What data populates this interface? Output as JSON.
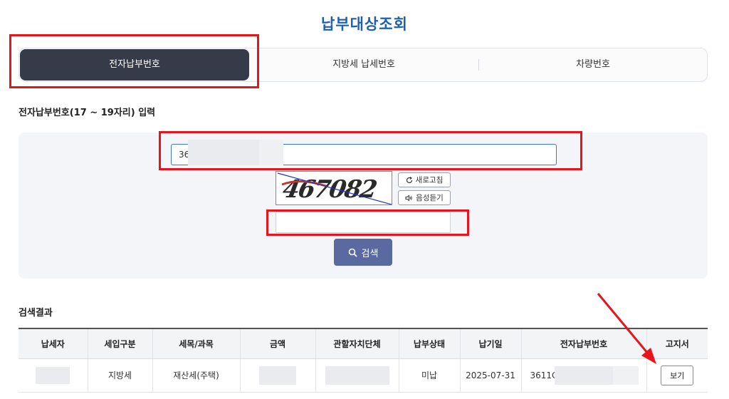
{
  "page": {
    "title": "납부대상조회"
  },
  "tabs": [
    {
      "label": "전자납부번호",
      "active": true
    },
    {
      "label": "지방세 납세번호",
      "active": false
    },
    {
      "label": "차량번호",
      "active": false
    }
  ],
  "form": {
    "section_label": "전자납부번호(17 ~ 19자리) 입력",
    "epay_input_value": "36",
    "captcha_text": "467082",
    "refresh_label": "새로고침",
    "listen_label": "음성듣기",
    "search_label": "검색"
  },
  "results": {
    "title": "검색결과",
    "columns": [
      "납세자",
      "세입구분",
      "세목/과목",
      "금액",
      "관할자치단체",
      "납부상태",
      "납기일",
      "전자납부번호",
      "고지서"
    ],
    "rows": [
      {
        "taxpayer": "",
        "revenue_type": "지방세",
        "tax_item": "재산세(주택)",
        "amount": "",
        "jurisdiction": "",
        "status": "미납",
        "due_date": "2025-07-31",
        "epay_number": "3611C",
        "notice_label": "보기"
      }
    ]
  },
  "colors": {
    "accent": "#1f5fb0",
    "highlight": "#e8141b",
    "tab_active": "#363b49",
    "search_button": "#5a6aa0"
  }
}
